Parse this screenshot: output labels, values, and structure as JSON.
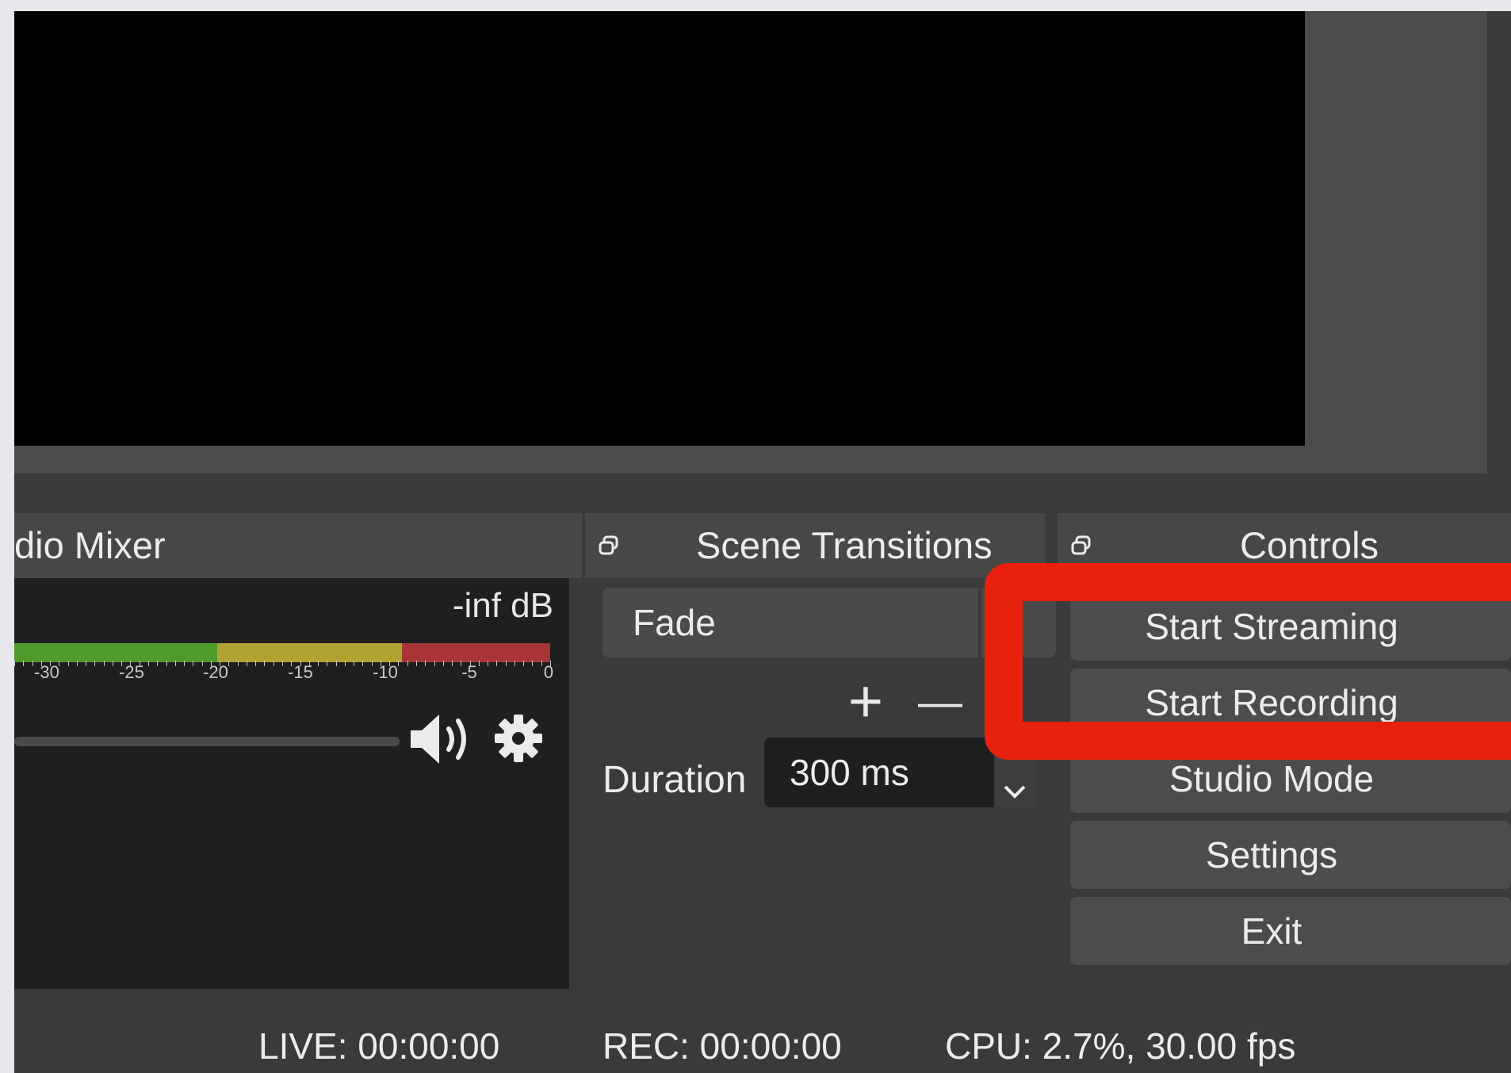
{
  "audio_mixer": {
    "title": "dio Mixer",
    "level": "-inf dB",
    "scale_ticks": [
      "-30",
      "-25",
      "-20",
      "-15",
      "-10",
      "-5",
      "0"
    ],
    "meter_colors": {
      "green": "#4f9a2a",
      "yellow": "#b0a332",
      "red": "#a83437"
    }
  },
  "scene_transitions": {
    "title": "Scene Transitions",
    "transition": "Fade",
    "add_label": "+",
    "remove_label": "—",
    "duration_label": "Duration",
    "duration_value": "300 ms"
  },
  "controls": {
    "title": "Controls",
    "buttons": {
      "start_streaming": "Start Streaming",
      "start_recording": "Start Recording",
      "studio_mode": "Studio Mode",
      "settings": "Settings",
      "exit": "Exit"
    }
  },
  "status_bar": {
    "live": "LIVE: 00:00:00",
    "rec": "REC: 00:00:00",
    "cpu": "CPU: 2.7%, 30.00 fps"
  },
  "colors": {
    "highlight": "#e8210f",
    "background": "#3a3a3a",
    "preview": "#000000"
  },
  "icons": [
    "float-icon",
    "speaker-icon",
    "gear-icon",
    "chevron-down-icon"
  ]
}
